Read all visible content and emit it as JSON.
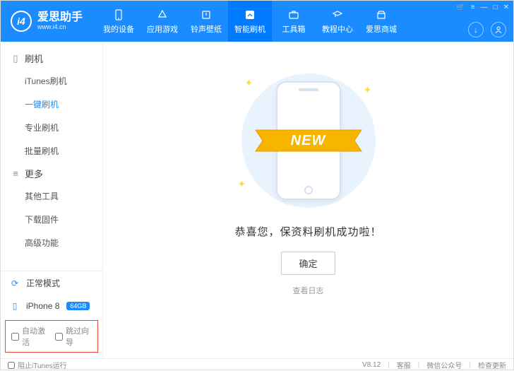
{
  "app": {
    "name": "爱思助手",
    "url": "www.i4.cn",
    "logo_text": "i4"
  },
  "topnav": [
    {
      "label": "我的设备"
    },
    {
      "label": "应用游戏"
    },
    {
      "label": "铃声壁纸"
    },
    {
      "label": "智能刷机",
      "active": true
    },
    {
      "label": "工具箱"
    },
    {
      "label": "教程中心"
    },
    {
      "label": "爱思商城"
    }
  ],
  "sidebar": {
    "group1": {
      "title": "刷机",
      "items": [
        "iTunes刷机",
        "一键刷机",
        "专业刷机",
        "批量刷机"
      ],
      "active_index": 1
    },
    "group2": {
      "title": "更多",
      "items": [
        "其他工具",
        "下载固件",
        "高级功能"
      ]
    }
  },
  "device": {
    "mode": "正常模式",
    "name": "iPhone 8",
    "storage": "64GB"
  },
  "checkboxes": {
    "auto_activate": "自动激活",
    "skip_guide": "跳过向导"
  },
  "main": {
    "ribbon": "NEW",
    "message": "恭喜您，保资料刷机成功啦！",
    "confirm": "确定",
    "log": "查看日志"
  },
  "footer": {
    "block_itunes": "阻止iTunes运行",
    "version": "V8.12",
    "links": [
      "客服",
      "微信公众号",
      "检查更新"
    ]
  }
}
